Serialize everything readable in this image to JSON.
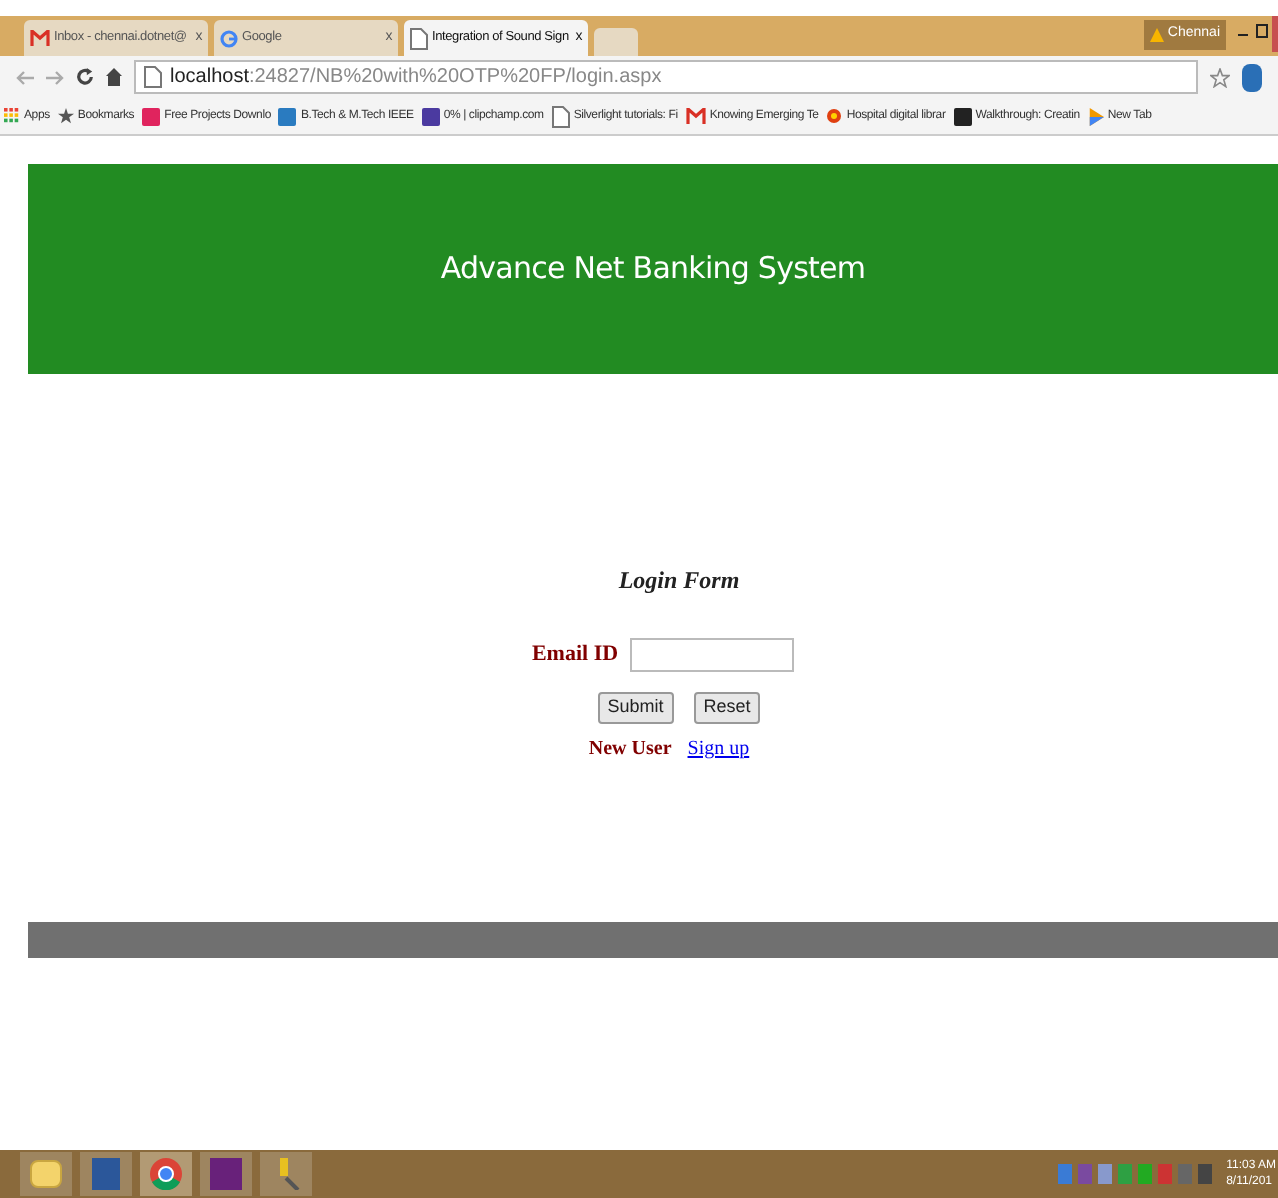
{
  "browser": {
    "tabs": [
      {
        "title": "Inbox - chennai.dotnet@",
        "close": "x",
        "selected": false
      },
      {
        "title": "Google",
        "close": "x",
        "selected": false
      },
      {
        "title": "Integration of Sound Sign",
        "close": "x",
        "selected": true
      }
    ],
    "user": "Chennai",
    "address": {
      "host": "localhost",
      "rest": ":24827/NB%20with%20OTP%20FP/login.aspx"
    },
    "bookmarks": [
      {
        "label": "Apps"
      },
      {
        "label": "Bookmarks"
      },
      {
        "label": "Free Projects Downlo"
      },
      {
        "label": "B.Tech & M.Tech IEEE"
      },
      {
        "label": "0% | clipchamp.com"
      },
      {
        "label": "Silverlight tutorials: Fi"
      },
      {
        "label": "Knowing Emerging Te"
      },
      {
        "label": "Hospital digital librar"
      },
      {
        "label": "Walkthrough: Creatin"
      },
      {
        "label": "New Tab"
      }
    ]
  },
  "page": {
    "banner": "Advance Net Banking System",
    "form": {
      "title": "Login Form",
      "email_label": "Email ID",
      "buttons": [
        "Submit",
        "Reset"
      ],
      "new_user": "New User",
      "signup": "Sign up"
    }
  },
  "taskbar": {
    "time": "11:03 AM",
    "date": "8/11/201"
  }
}
